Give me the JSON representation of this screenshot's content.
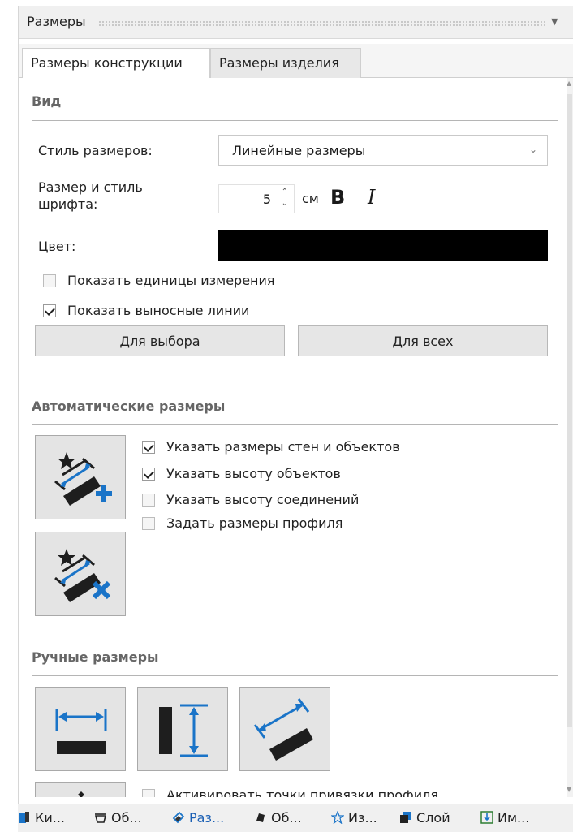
{
  "window": {
    "title": "Размеры"
  },
  "tabs": [
    {
      "label": "Размеры конструкции",
      "active": true
    },
    {
      "label": "Размеры изделия",
      "active": false
    }
  ],
  "view_section": {
    "title": "Вид",
    "style_label": "Стиль размеров:",
    "style_value": "Линейные размеры",
    "font_label_line1": "Размер и стиль",
    "font_label_line2": "шрифта:",
    "font_size": "5",
    "font_unit": "см",
    "bold": "B",
    "italic": "I",
    "color_label": "Цвет:",
    "color_value": "#000000",
    "show_units": {
      "label": "Показать единицы измерения",
      "checked": false
    },
    "show_ext_lines": {
      "label": "Показать выносные линии",
      "checked": true
    },
    "btn_selection": "Для выбора",
    "btn_all": "Для всех"
  },
  "auto_section": {
    "title": "Автоматические размеры",
    "options": [
      {
        "label": "Указать размеры стен и объектов",
        "checked": true
      },
      {
        "label": "Указать высоту объектов",
        "checked": true
      },
      {
        "label": "Указать высоту соединений",
        "checked": false
      },
      {
        "label": "Задать размеры профиля",
        "checked": false
      }
    ]
  },
  "manual_section": {
    "title": "Ручные размеры",
    "snap_option": {
      "label": "Активировать точки привязки профиля",
      "checked": false
    }
  },
  "bottom_tabs": [
    {
      "label": "Ки...",
      "icon": "book-icon"
    },
    {
      "label": "Об...",
      "icon": "pot-icon"
    },
    {
      "label": "Раз...",
      "icon": "dimension-icon",
      "active": true
    },
    {
      "label": "Об...",
      "icon": "object-icon"
    },
    {
      "label": "Из...",
      "icon": "star-icon"
    },
    {
      "label": "Слой",
      "icon": "layer-icon"
    },
    {
      "label": "Им...",
      "icon": "import-icon"
    }
  ],
  "colors": {
    "accent": "#1a74c8",
    "icon_dark": "#1e1e1e"
  }
}
